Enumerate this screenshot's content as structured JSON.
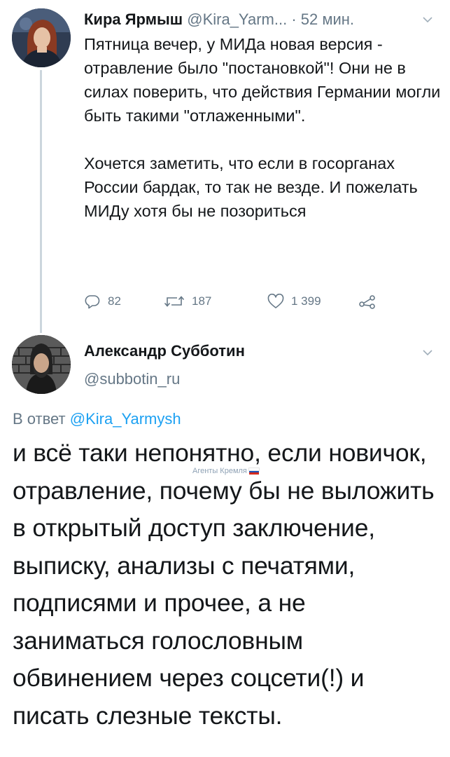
{
  "tweet1": {
    "author_name": "Кира Ярмыш",
    "author_handle": "@Kira_Yarm...",
    "separator": "·",
    "time": "52 мин.",
    "paragraphs": [
      "Пятница вечер, у МИДа новая версия - отравление было \"постановкой\"! Они не в силах поверить, что действия Германии могли быть такими \"отлаженными\".",
      "Хочется заметить, что если в госорганах России бардак, то так не везде. И пожелать МИДу хотя бы не позориться"
    ],
    "actions": {
      "replies": "82",
      "retweets": "187",
      "likes": "1 399"
    }
  },
  "tweet2": {
    "author_name": "Александр Субботин",
    "author_handle": "@subbotin_ru",
    "reply_prefix": "В ответ",
    "reply_to": "@Kira_Yarmysh",
    "text": "и всё таки непонятно, если новичок, отравление, почему бы не выложить в открытый доступ заключение, выписку, анализы с печатями, подписями и прочее, а не заниматься голословным обвинением через соцсети(!) и писать слезные тексты."
  },
  "watermark": "Агенты Кремля",
  "icons": {
    "reply": "reply-icon",
    "retweet": "retweet-icon",
    "like": "heart-icon",
    "share": "share-icon",
    "menu": "chevron-down-icon"
  },
  "colors": {
    "text": "#14171a",
    "secondary": "#657786",
    "link": "#1da1f2",
    "thread_line": "#ccd6dd"
  }
}
